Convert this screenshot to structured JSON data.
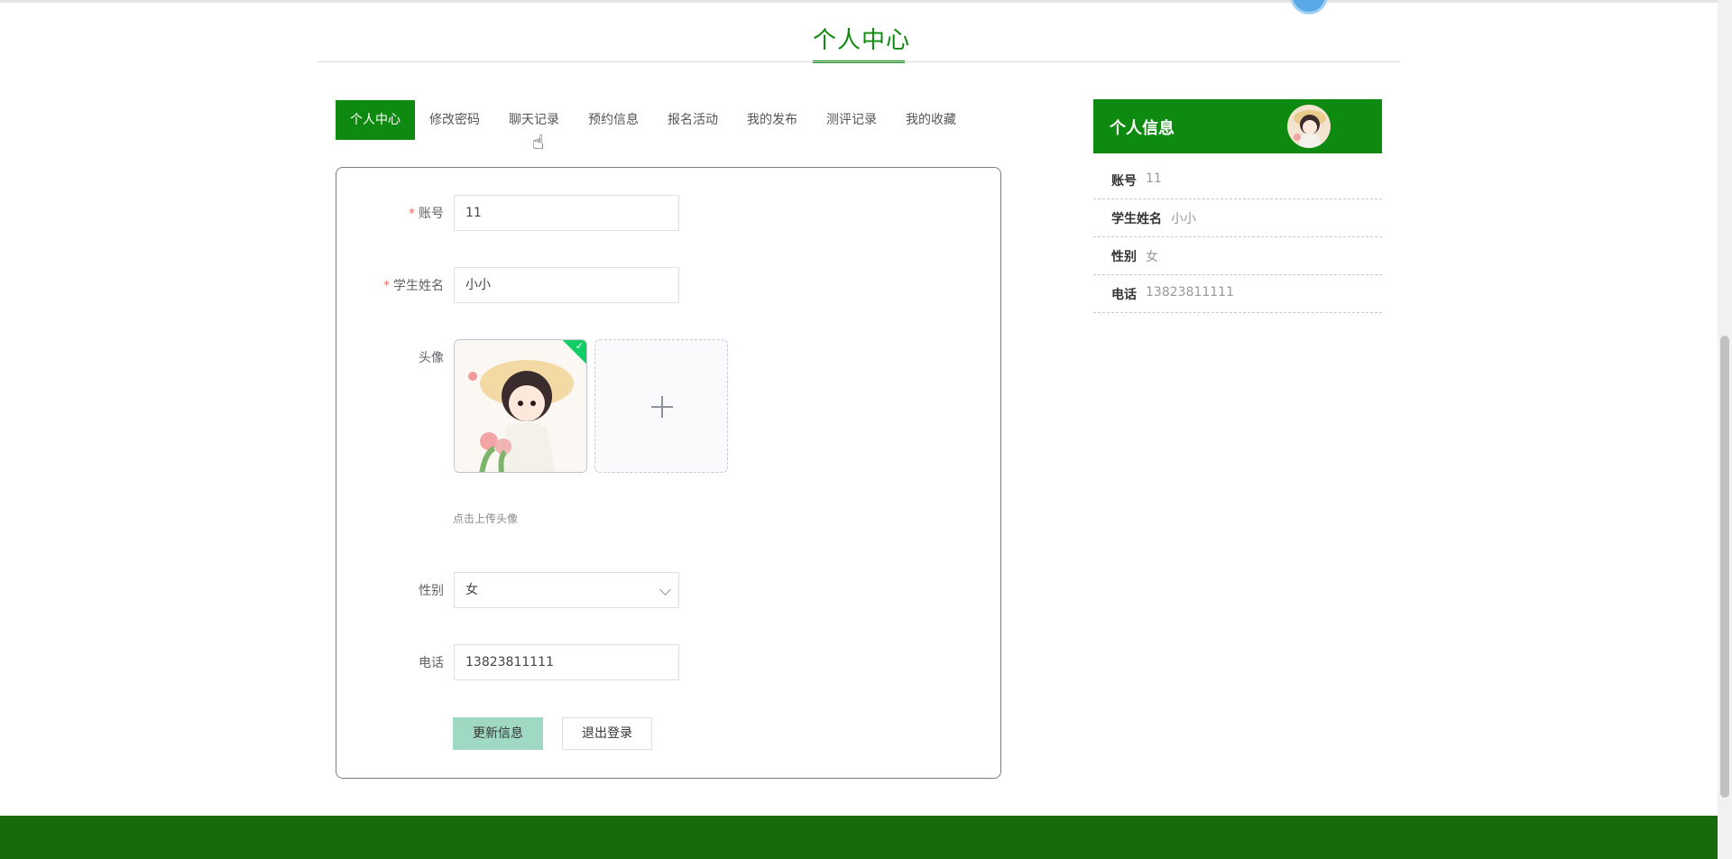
{
  "page": {
    "title": "个人中心"
  },
  "tabs": [
    {
      "label": "个人中心",
      "active": true
    },
    {
      "label": "修改密码"
    },
    {
      "label": "聊天记录"
    },
    {
      "label": "预约信息"
    },
    {
      "label": "报名活动"
    },
    {
      "label": "我的发布"
    },
    {
      "label": "测评记录"
    },
    {
      "label": "我的收藏"
    }
  ],
  "form": {
    "required_mark": "*",
    "account": {
      "label": "账号",
      "value": "11"
    },
    "student_name": {
      "label": "学生姓名",
      "value": "小小"
    },
    "avatar": {
      "label": "头像",
      "upload_tip": "点击上传头像",
      "add_icon": "plus-icon",
      "check_icon": "check-icon"
    },
    "gender": {
      "label": "性别",
      "value": "女"
    },
    "phone": {
      "label": "电话",
      "value": "13823811111"
    },
    "update_button": "更新信息",
    "logout_button": "退出登录"
  },
  "info_panel": {
    "title": "个人信息",
    "rows": [
      {
        "key": "账号",
        "value": "11"
      },
      {
        "key": "学生姓名",
        "value": "小小"
      },
      {
        "key": "性别",
        "value": "女"
      },
      {
        "key": "电话",
        "value": "13823811111"
      }
    ]
  },
  "colors": {
    "primary": "#0f8a10",
    "footer": "#176b0b",
    "update_button": "#a0d9c3",
    "required": "#f56c6c"
  }
}
